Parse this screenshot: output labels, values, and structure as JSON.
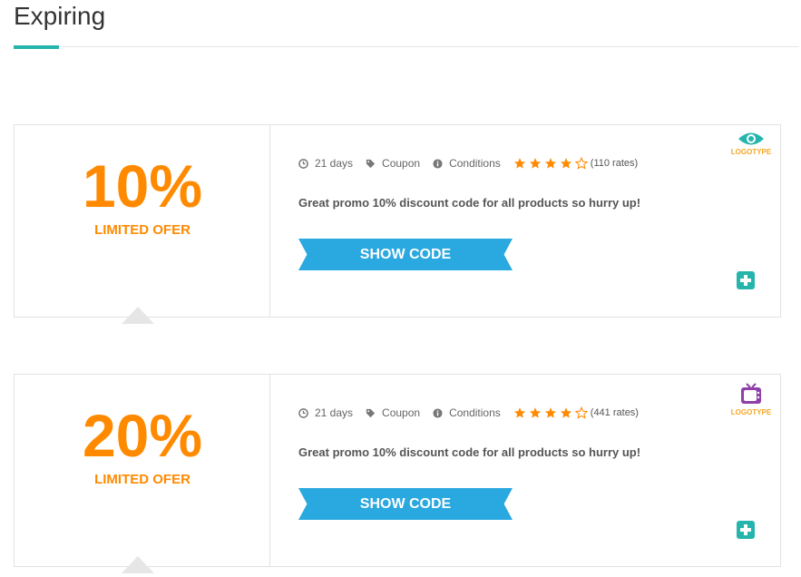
{
  "section": {
    "title": "Expiring"
  },
  "coupons": [
    {
      "discount": "10%",
      "limited": "LIMITED OFER",
      "days": "21 days",
      "type": "Coupon",
      "conditions": "Conditions",
      "rating": 4,
      "rating_max": 5,
      "rates": "(110 rates)",
      "description": "Great promo 10% discount code for all products so hurry up!",
      "show_code": "SHOW CODE",
      "logo": {
        "text": "LOGOTYPE",
        "icon": "eye-icon",
        "color": "#26b5ad"
      }
    },
    {
      "discount": "20%",
      "limited": "LIMITED OFER",
      "days": "21 days",
      "type": "Coupon",
      "conditions": "Conditions",
      "rating": 4,
      "rating_max": 5,
      "rates": "(441 rates)",
      "description": "Great promo 10% discount code for all products so hurry up!",
      "show_code": "SHOW CODE",
      "logo": {
        "text": "LOGOTYPE",
        "icon": "tv-icon",
        "color": "#8e3fa8"
      }
    }
  ],
  "colors": {
    "accent": "#26b5ad",
    "discount": "#ff8a00",
    "show_code_bg": "#2aa8e0",
    "star": "#ff8a00"
  },
  "icons": {
    "days": "clock-icon",
    "type": "tag-icon",
    "conditions": "info-icon",
    "star": "star-icon",
    "add": "plus-icon"
  }
}
